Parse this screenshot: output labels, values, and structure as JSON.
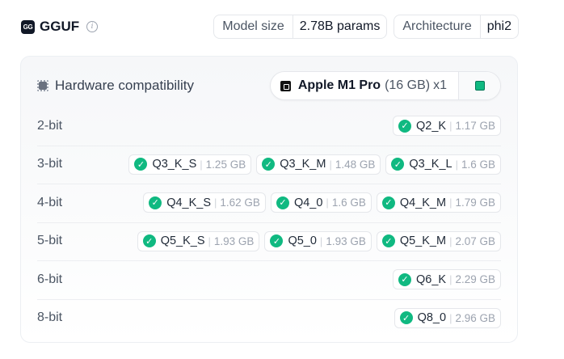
{
  "header": {
    "gguf_icon_text": "GG",
    "title": "GGUF",
    "info_icon": "info-icon",
    "model_size_label": "Model size",
    "model_size_value": "2.78B params",
    "architecture_label": "Architecture",
    "architecture_value": "phi2"
  },
  "hardware": {
    "title": "Hardware compatibility",
    "device_name": "Apple M1 Pro",
    "device_memory": "(16 GB)",
    "device_count": "x1",
    "icons": {
      "chip": "chip-icon",
      "apple": "apple-icon",
      "settings": "green-chip-icon"
    }
  },
  "colors": {
    "accent_green": "#10b981",
    "border": "#e5e7eb"
  },
  "rows": [
    {
      "bits": "2-bit",
      "quants": [
        {
          "name": "Q2_K",
          "size": "1.17 GB"
        }
      ]
    },
    {
      "bits": "3-bit",
      "quants": [
        {
          "name": "Q3_K_S",
          "size": "1.25 GB"
        },
        {
          "name": "Q3_K_M",
          "size": "1.48 GB"
        },
        {
          "name": "Q3_K_L",
          "size": "1.6 GB"
        }
      ]
    },
    {
      "bits": "4-bit",
      "quants": [
        {
          "name": "Q4_K_S",
          "size": "1.62 GB"
        },
        {
          "name": "Q4_0",
          "size": "1.6 GB"
        },
        {
          "name": "Q4_K_M",
          "size": "1.79 GB"
        }
      ]
    },
    {
      "bits": "5-bit",
      "quants": [
        {
          "name": "Q5_K_S",
          "size": "1.93 GB"
        },
        {
          "name": "Q5_0",
          "size": "1.93 GB"
        },
        {
          "name": "Q5_K_M",
          "size": "2.07 GB"
        }
      ]
    },
    {
      "bits": "6-bit",
      "quants": [
        {
          "name": "Q6_K",
          "size": "2.29 GB"
        }
      ]
    },
    {
      "bits": "8-bit",
      "quants": [
        {
          "name": "Q8_0",
          "size": "2.96 GB"
        }
      ]
    }
  ]
}
